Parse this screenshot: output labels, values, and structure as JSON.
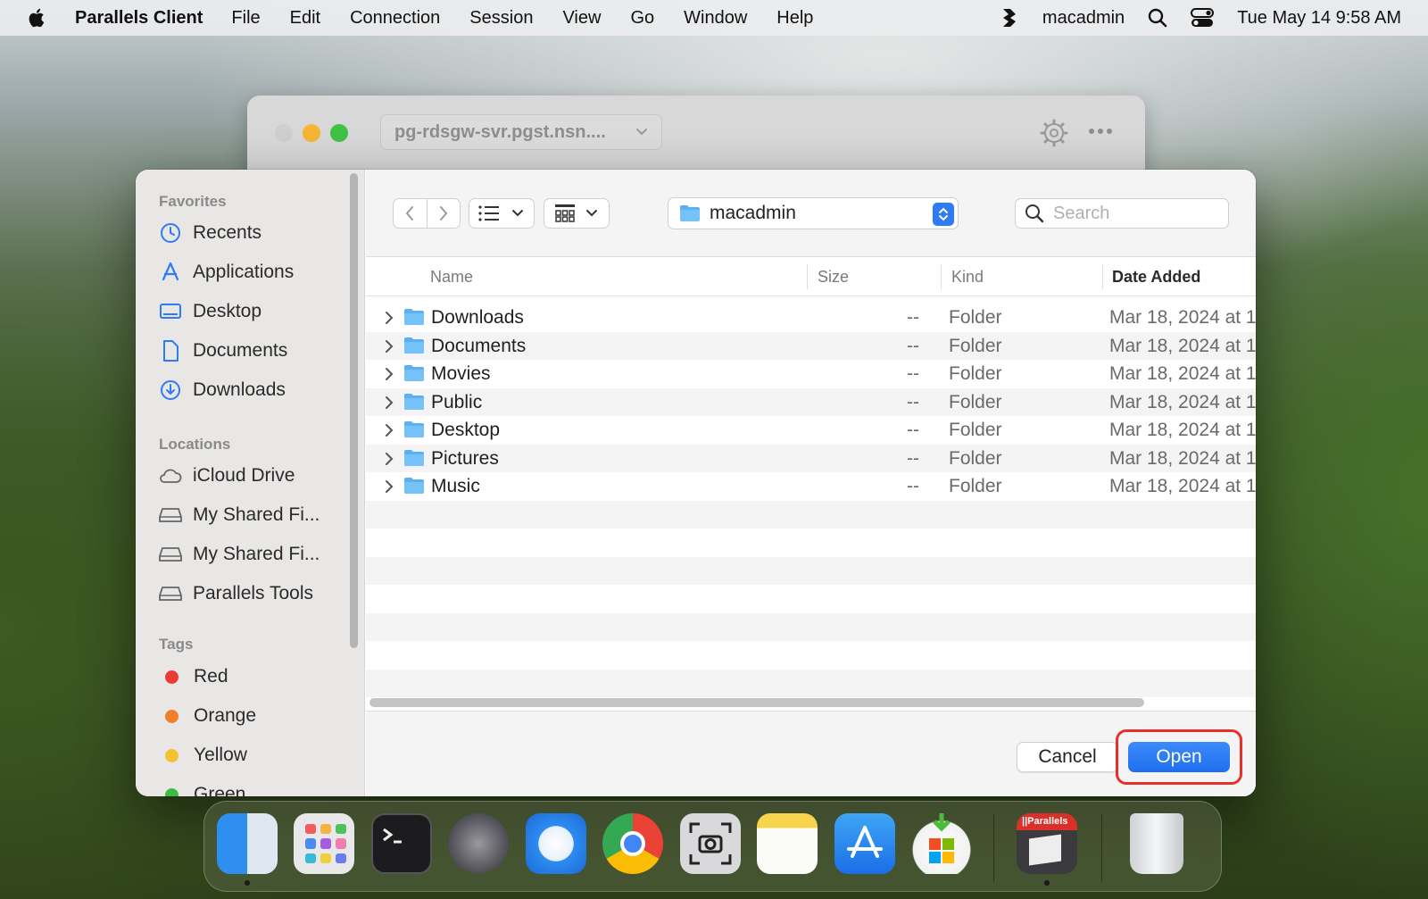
{
  "menubar": {
    "app_name": "Parallels Client",
    "menus": [
      "File",
      "Edit",
      "Connection",
      "Session",
      "View",
      "Go",
      "Window",
      "Help"
    ],
    "user": "macadmin",
    "clock": "Tue May 14  9:58 AM"
  },
  "background_window": {
    "server": "pg-rdsgw-svr.pgst.nsn...."
  },
  "sidebar": {
    "favorites_heading": "Favorites",
    "favorites": [
      {
        "label": "Recents",
        "icon": "clock-icon"
      },
      {
        "label": "Applications",
        "icon": "applications-icon"
      },
      {
        "label": "Desktop",
        "icon": "desktop-icon"
      },
      {
        "label": "Documents",
        "icon": "document-icon"
      },
      {
        "label": "Downloads",
        "icon": "download-icon"
      }
    ],
    "locations_heading": "Locations",
    "locations": [
      {
        "label": "iCloud Drive",
        "icon": "cloud-icon"
      },
      {
        "label": "My Shared Fi...",
        "icon": "drive-icon"
      },
      {
        "label": "My Shared Fi...",
        "icon": "drive-icon"
      },
      {
        "label": "Parallels Tools",
        "icon": "drive-icon"
      }
    ],
    "tags_heading": "Tags",
    "tags": [
      {
        "label": "Red",
        "color": "#ec3b35"
      },
      {
        "label": "Orange",
        "color": "#f0802b"
      },
      {
        "label": "Yellow",
        "color": "#f2c230"
      },
      {
        "label": "Green",
        "color": "#3fbb48"
      }
    ]
  },
  "toolbar": {
    "current_folder": "macadmin",
    "search_placeholder": "Search"
  },
  "columns": {
    "name": "Name",
    "size": "Size",
    "kind": "Kind",
    "date_added": "Date Added"
  },
  "files": [
    {
      "name": "Downloads",
      "size": "--",
      "kind": "Folder",
      "date": "Mar 18, 2024 at 1"
    },
    {
      "name": "Documents",
      "size": "--",
      "kind": "Folder",
      "date": "Mar 18, 2024 at 1"
    },
    {
      "name": "Movies",
      "size": "--",
      "kind": "Folder",
      "date": "Mar 18, 2024 at 1"
    },
    {
      "name": "Public",
      "size": "--",
      "kind": "Folder",
      "date": "Mar 18, 2024 at 1"
    },
    {
      "name": "Desktop",
      "size": "--",
      "kind": "Folder",
      "date": "Mar 18, 2024 at 1"
    },
    {
      "name": "Pictures",
      "size": "--",
      "kind": "Folder",
      "date": "Mar 18, 2024 at 1"
    },
    {
      "name": "Music",
      "size": "--",
      "kind": "Folder",
      "date": "Mar 18, 2024 at 1"
    }
  ],
  "buttons": {
    "cancel": "Cancel",
    "open": "Open"
  },
  "dock": {
    "apps": [
      "Finder",
      "Launchpad",
      "Terminal",
      "System Settings",
      "Safari",
      "Chrome",
      "Screenshot",
      "Notes",
      "App Store",
      "Microsoft Installer",
      "Parallels Client",
      "Trash"
    ],
    "parallels_badge": "||Parallels"
  }
}
